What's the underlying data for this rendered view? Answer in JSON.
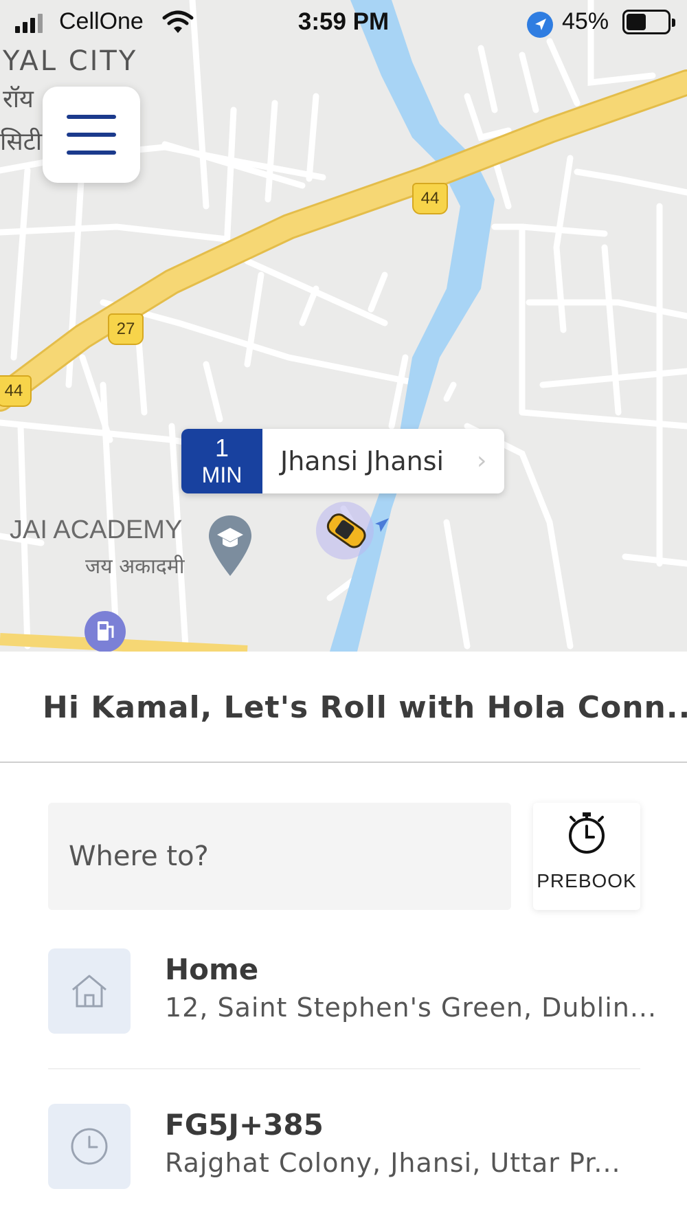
{
  "status_bar": {
    "carrier": "CellOne",
    "time": "3:59 PM",
    "battery_percent": "45%",
    "icons": [
      "signal-icon",
      "wifi-icon",
      "location-arrow-icon",
      "battery-icon"
    ]
  },
  "map": {
    "labels": {
      "city": "YAL CITY",
      "city_hindi_1": "रॉय",
      "city_hindi_2": "सिटी",
      "academy": "JAI ACADEMY",
      "academy_hindi": "जय अकादमी"
    },
    "route_shields": [
      "44",
      "27",
      "44"
    ],
    "colors": {
      "water": "#a8d4f5",
      "highway": "#f6d774",
      "road": "#ffffff",
      "land": "#ebebea"
    }
  },
  "menu": {
    "icon": "hamburger-menu-icon"
  },
  "eta": {
    "number": "1",
    "unit": "MIN",
    "place": "Jhansi Jhansi",
    "accent": "#18419f"
  },
  "greeting": "Hi Kamal, Let's Roll with Hola Conn...",
  "search": {
    "placeholder": "Where to?"
  },
  "prebook": {
    "label": "PREBOOK",
    "icon": "stopwatch-icon"
  },
  "saved_places": [
    {
      "icon": "home-icon",
      "title": "Home",
      "subtitle": "12, Saint Stephen's Green, Dublin..."
    },
    {
      "icon": "clock-icon",
      "title": "FG5J+385",
      "subtitle": "Rajghat Colony,  Jhansi,  Uttar Pr..."
    }
  ]
}
